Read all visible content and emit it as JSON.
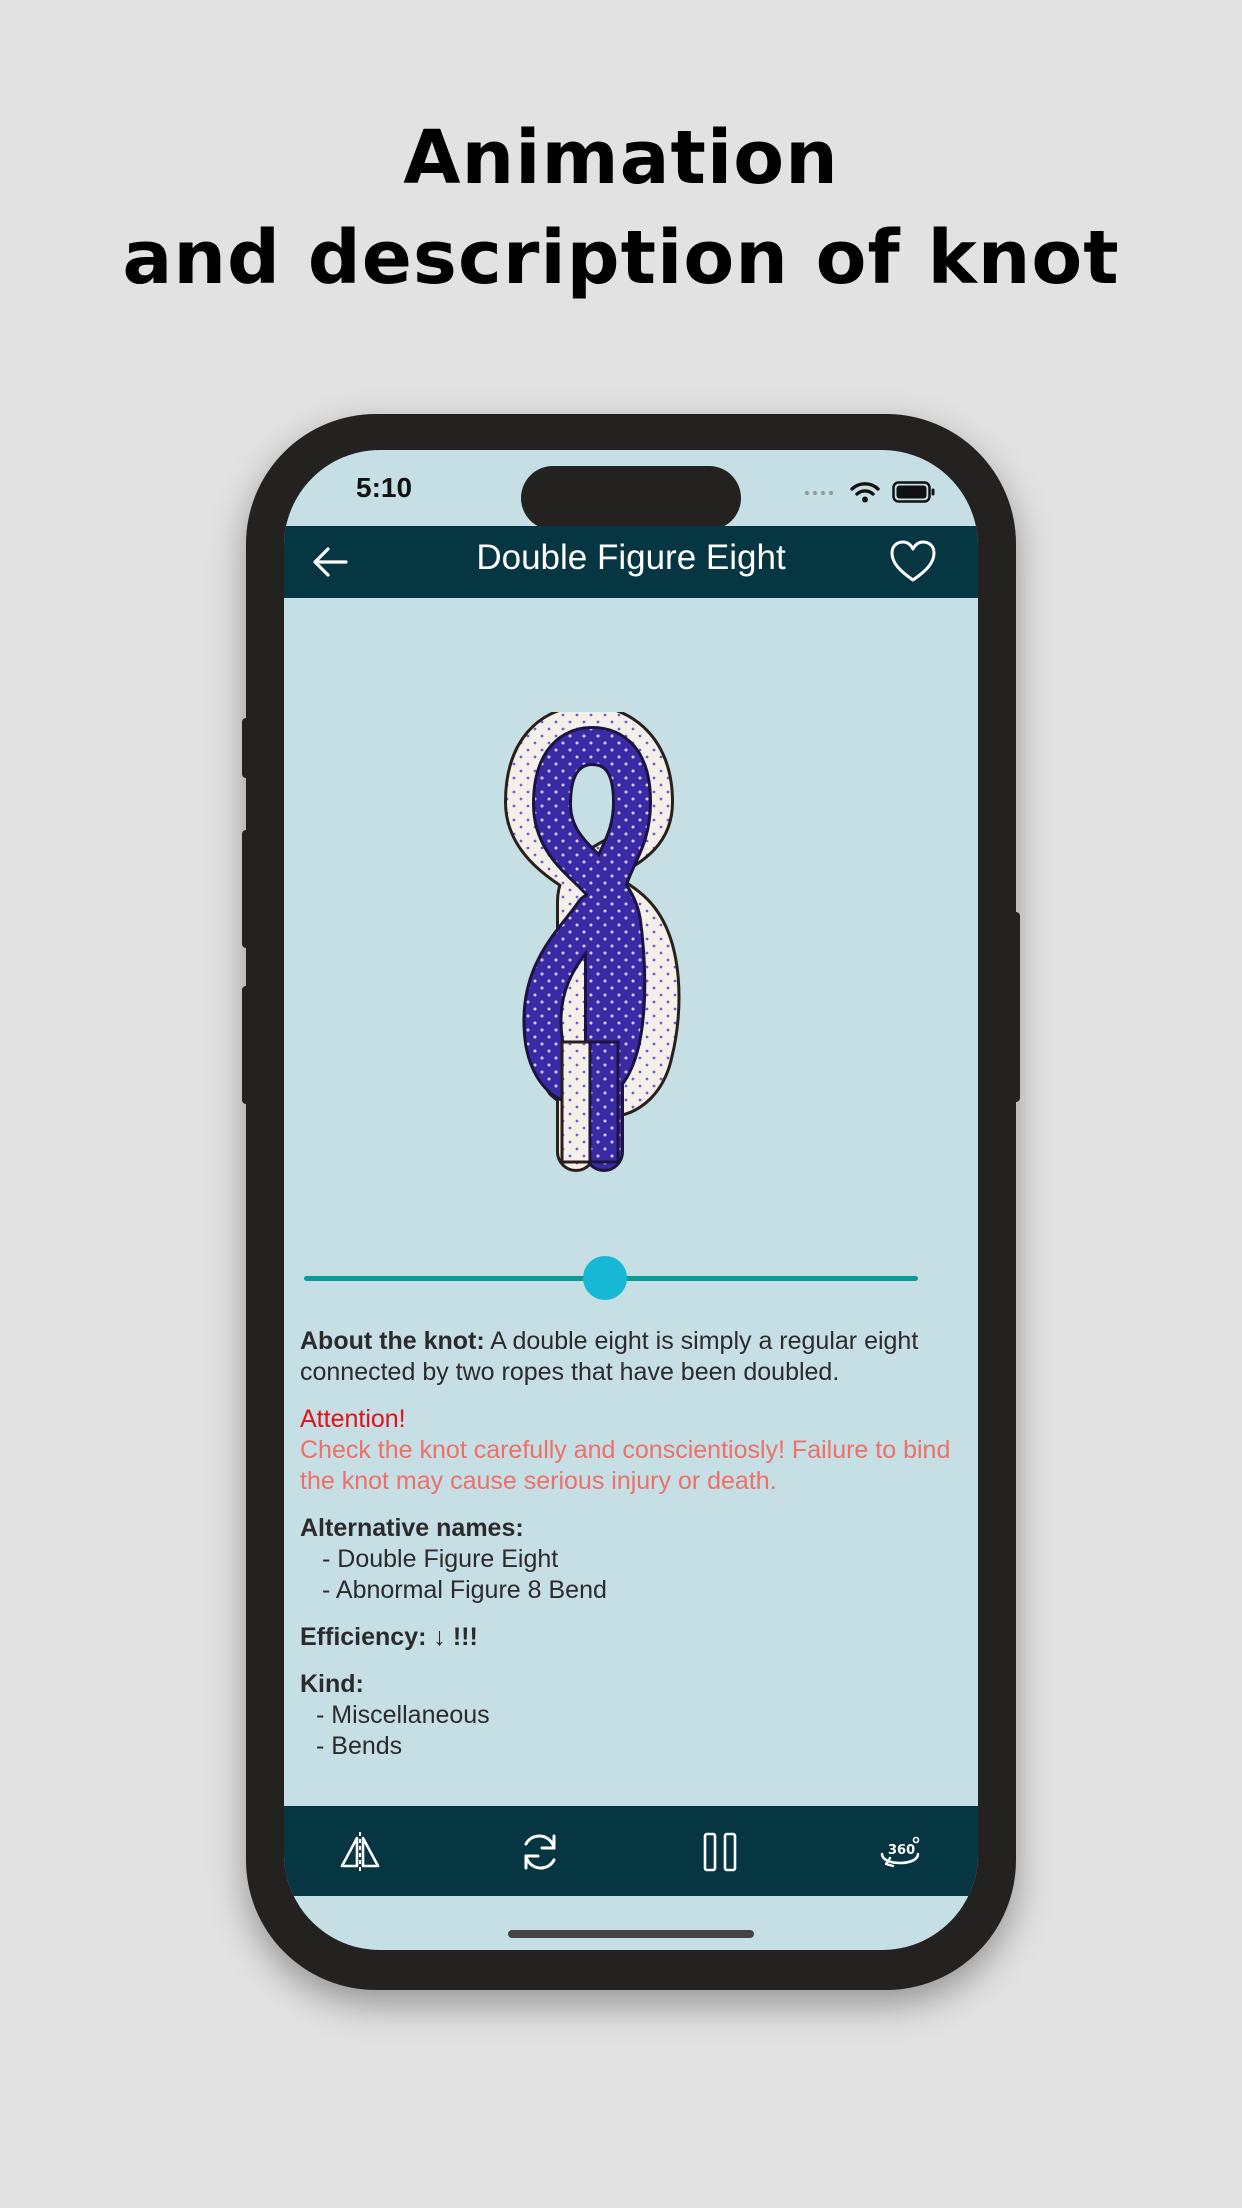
{
  "headline": {
    "line1": "Animation",
    "line2": "and description of knot"
  },
  "status_bar": {
    "time": "5:10",
    "icons": [
      "signal-icon",
      "wifi-icon",
      "battery-icon"
    ]
  },
  "app_bar": {
    "back_icon": "arrow-left-icon",
    "title": "Double Figure Eight",
    "favorite_icon": "heart-outline-icon"
  },
  "animation": {
    "progress": 0.49
  },
  "description": {
    "about_label": "About the knot:",
    "about_text": " A double eight is simply a regular eight connected by two ropes that have been doubled.",
    "attention_title": "Attention!",
    "attention_text": "Check the knot carefully and conscientiosly! Failure to bind the knot may cause serious injury or death.",
    "alt_names_label": "Alternative names:",
    "alt_names": [
      "- Double Figure Eight",
      "- Abnormal Figure 8 Bend"
    ],
    "efficiency_label": "Efficiency:",
    "efficiency_value": "↓ !!!",
    "kind_label": "Kind:",
    "kinds": [
      "- Miscellaneous",
      "- Bends"
    ]
  },
  "bottom_bar": {
    "buttons": [
      "mirror-icon",
      "refresh-icon",
      "pause-icon",
      "rotate-360-icon"
    ]
  },
  "colors": {
    "background": "#e2e2e2",
    "screen": "#c5dfe5",
    "bar": "#063642",
    "slider_track": "#0b9a9a",
    "slider_thumb": "#17b8d6",
    "attention": "#e0101a",
    "attention_text": "#ee7068",
    "rope_blue": "#3b2aa6",
    "rope_white": "#f4efe8"
  }
}
